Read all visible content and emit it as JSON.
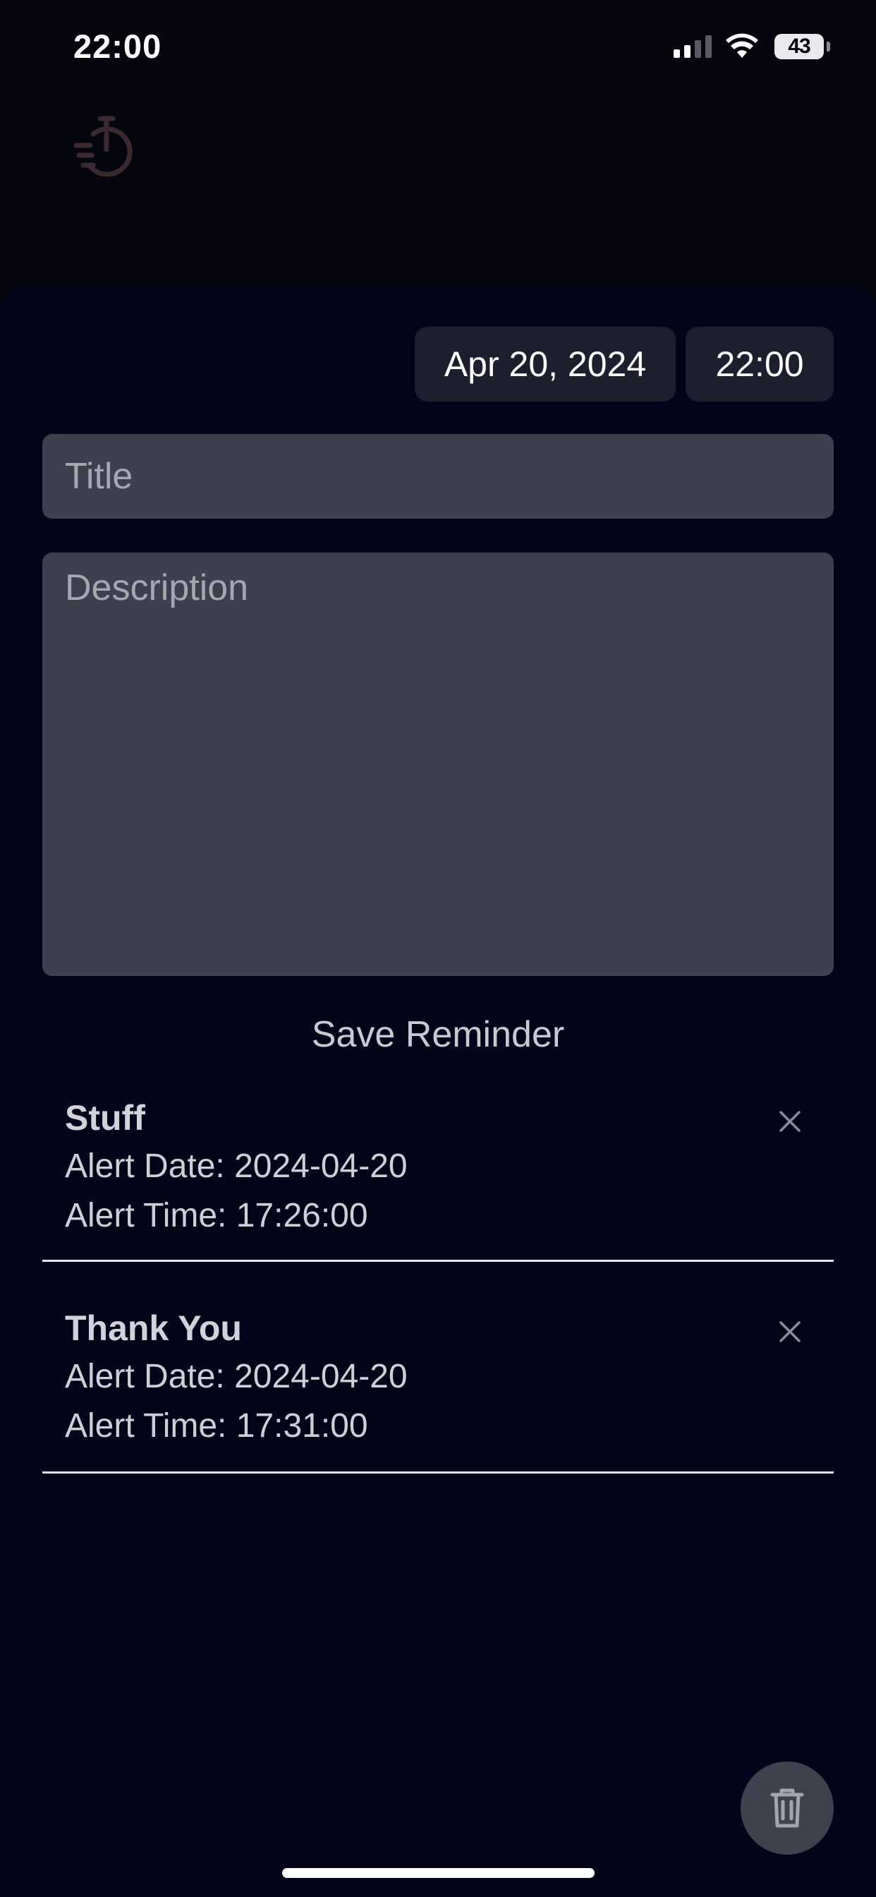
{
  "status_bar": {
    "time": "22:00",
    "battery": "43"
  },
  "app": {
    "icon": "stopwatch-icon"
  },
  "form": {
    "date": "Apr 20, 2024",
    "time": "22:00",
    "title_placeholder": "Title",
    "description_placeholder": "Description",
    "save_label": "Save Reminder"
  },
  "reminders": [
    {
      "title": "Stuff",
      "date_line": "Alert Date: 2024-04-20",
      "time_line": "Alert Time: 17:26:00"
    },
    {
      "title": "Thank You",
      "date_line": "Alert Date: 2024-04-20",
      "time_line": "Alert Time: 17:31:00"
    }
  ],
  "icons": {
    "delete": "close-icon",
    "clear_all": "trash-icon"
  },
  "colors": {
    "background": "#05050d",
    "sheet": "#03031a",
    "input": "#3e4050",
    "pill": "#1d1e2e",
    "app_icon": "#3a2a30"
  }
}
